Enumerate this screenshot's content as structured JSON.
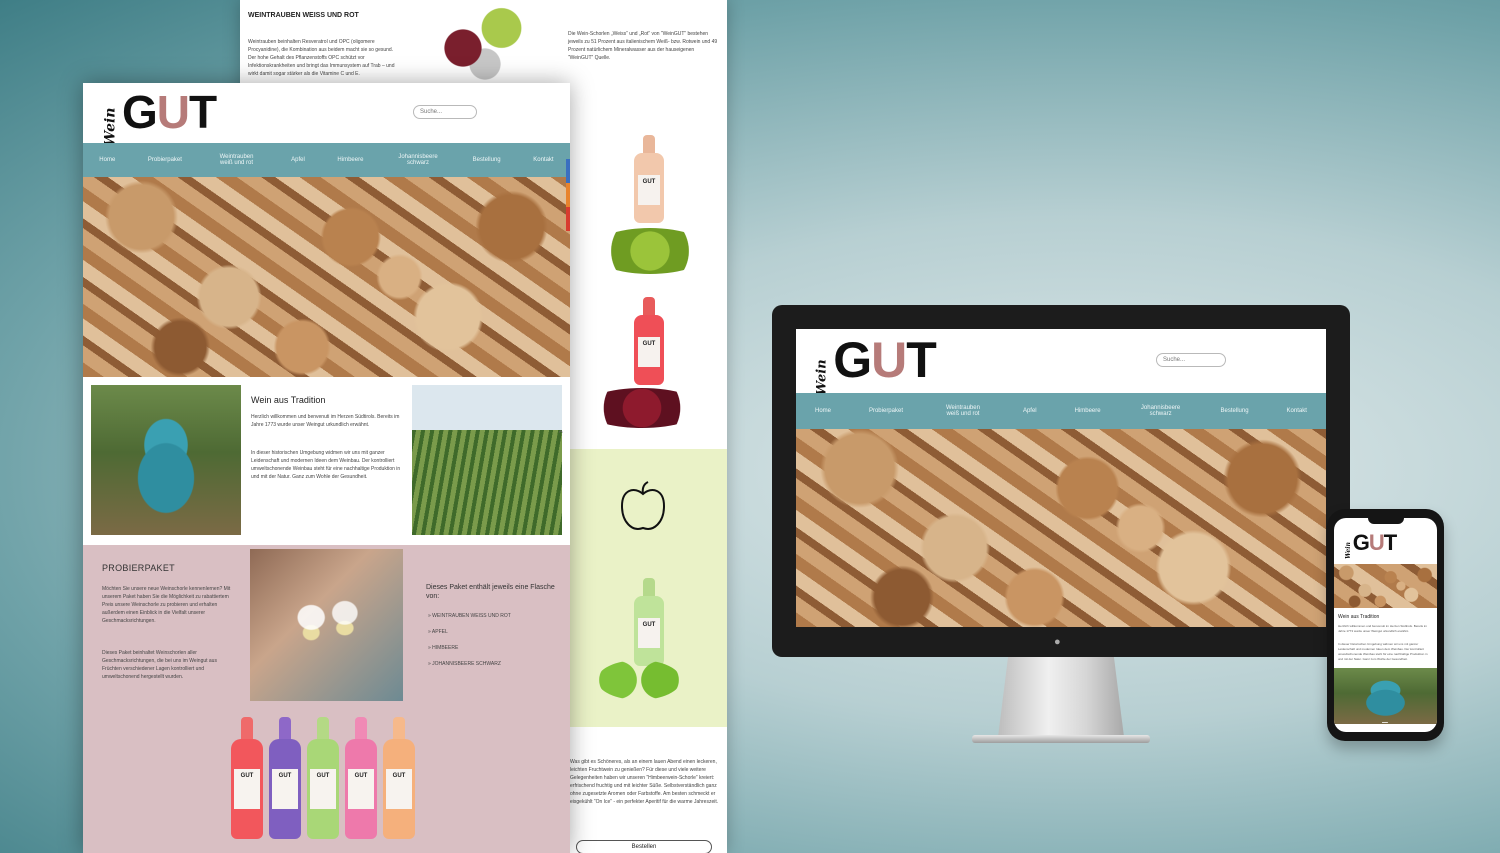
{
  "back_page": {
    "heading": "WEINTRAUBEN WEISS UND ROT",
    "intro": "Weintrauben beinhalten Resveratrol und OPC (oligomere Procyanidine), die Kombination aus beidem macht sie so gesund. Der hohe Gehalt des Pflanzenstoffs OPC schützt vor Infektionskrankheiten und bringt das Immunsystem auf Trab – und wirkt damit sogar stärker als die Vitamine C und E.",
    "right_text": "Die Wein-Schorlen „Weiss“ und „Rot“ von “WeinGUT” bestehen jeweils zu 51 Prozent aus italienischem Weiß- bzw. Rotwein und 49 Prozent natürlichem Mineralwasser aus der hauseigenen “WeinGUT” Quelle.",
    "bottle_label": "GUT",
    "bottom_text": "Was gibt es Schöneres, als an einem lauen Abend einen leckeren, leichten Fruchtwein zu genießen? Für diese und viele weitere Gelegenheiten haben wir unseren “Himbeerwein-Schorle” kreiert: erfrischend fruchtig und mit leichter Süße. Selbstverständlich ganz ohne zugesetzte Aromen oder Farbstoffe. Am besten schmeckt er eisgekühlt “On Ice” - ein perfekter Aperitif für die warme Jahreszeit.",
    "order_button": "Bestellen"
  },
  "site": {
    "logo_script": "Wein",
    "logo_block": "GUT",
    "search_placeholder": "Suche...",
    "nav": [
      "Home",
      "Probierpaket",
      "Weintrauben weiß und rot",
      "Apfel",
      "Himbeere",
      "Johannisbeere schwarz",
      "Bestellung",
      "Kontakt"
    ]
  },
  "front_page": {
    "tradition_title": "Wein aus Tradition",
    "tradition_text_1": "Herzlich willkommen und benvenuti im Herzen Südtirols. Bereits im Jahre 1773 wurde unser Weingut urkundlich erwähnt.",
    "tradition_text_2": "In dieser historischen Umgebung widmen wir uns mit ganzer Leidenschaft und modernen Ideen dem Weinbau. Der kontrolliert umweltschonende Weinbau steht für eine nachhaltige Produktion in und mit der Natur. Ganz zum Wohle der Gesundheit.",
    "probier_title": "PROBIERPAKET",
    "probier_text_1": "Möchten Sie unsere neue Weinschorle kennenlernen? Mit unserem Paket haben Sie die Möglichkeit zu rabattiertem Preis unsere Weinschorle zu probieren und erhalten außerdem einen Einblick in die Vielfalt unserer Geschmacksrichtungen.",
    "probier_text_2": "Dieses Paket beinhaltet Weinschorlen aller Geschmacksrichtungen, die bei uns im Weingut aus Früchten verschiedener Lagen kontrolliert und umweltschonend hergestellt wurden.",
    "package_title": "Dieses Paket enthält jeweils eine Flasche von:",
    "package_items": [
      "WEINTRAUBEN WEISS UND ROT",
      "APFEL",
      "HIMBEERE",
      "JOHANNISBEERE SCHWARZ"
    ],
    "bottle_label": "GUT"
  },
  "phone": {
    "title": "Wein aus Tradition",
    "text_1": "Herzlich willkommen und benvenuti im Herzen Südtirols. Bereits im Jahre 1773 wurde unser Weingut urkundlich erwähnt.",
    "text_2": "In dieser historischen Umgebung widmen wir uns mit ganzer Leidenschaft und modernen Ideen dem Weinbau. Der kontrolliert umweltschonende Weinbau steht für eine nachhaltige Produktion in und mit der Natur. Ganz zum Wohle der Gesundheit."
  },
  "colors": {
    "nav_teal": "#6aa3ab",
    "probier_pink": "#d9bfc3",
    "apple_green": "#eaf2c7",
    "logo_accent": "#b67b79"
  }
}
